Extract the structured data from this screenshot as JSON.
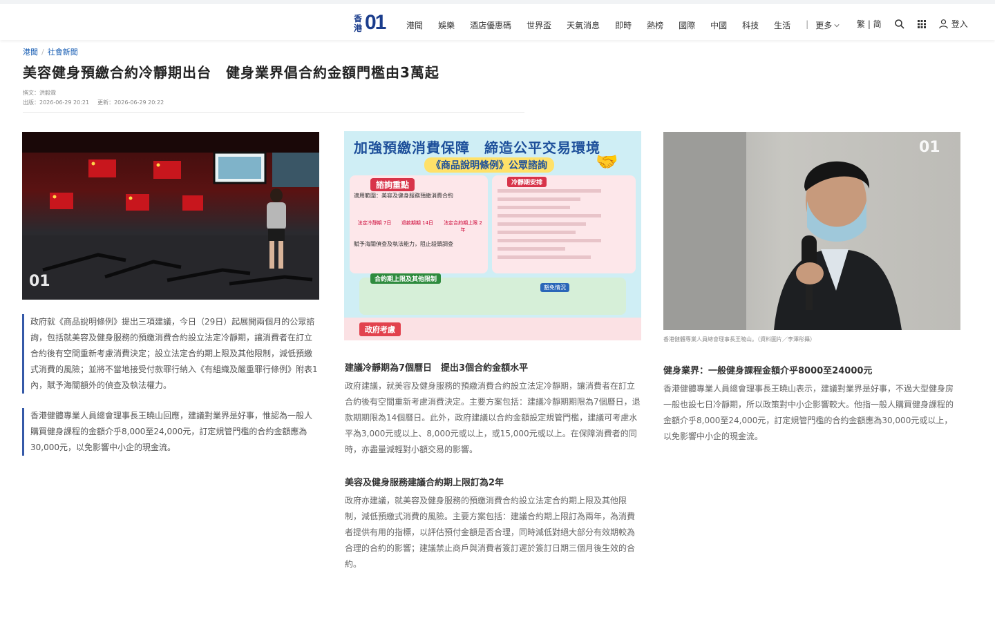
{
  "header": {
    "logo_hk": "香港",
    "logo_mark": "01",
    "nav": [
      "港聞",
      "娛樂",
      "酒店優惠碼",
      "世界盃",
      "天氣消息",
      "即時",
      "熱榜",
      "國際",
      "中國",
      "科技",
      "生活"
    ],
    "more": "更多",
    "lang": "繁 | 简",
    "login": "登入"
  },
  "breadcrumb": [
    "港聞",
    "社會新聞"
  ],
  "article": {
    "title": "美容健身預繳合約冷靜期出台　健身業界倡合約金額門檻由3萬起",
    "author": "撰文：洪毅霖",
    "published": "出版：2026-06-29 20:21",
    "updated": "更新：2026-06-29 20:22"
  },
  "col_left": {
    "quote1": "政府就《商品說明條例》提出三項建議，今日（29日）起展開兩個月的公眾諮詢，包括就美容及健身服務的預繳消費合約設立法定冷靜期，讓消費者在訂立合約後有空間重新考慮消費決定；設立法定合約期上限及其他限制，減低預繳式消費的風險；並將不當地接受付款罪行納入《有組織及嚴重罪行條例》附表1內，賦予海關額外的偵查及執法權力。",
    "quote2": "香港健體專業人員總會理事長王曉山回應，建議對業界是好事，惟認為一般人購買健身課程的金額介乎8,000至24,000元，訂定規管門檻的合約金額應為30,000元，以免影響中小企的現金流。"
  },
  "infographic": {
    "title": "加強預繳消費保障　締造公平交易環境",
    "subtitle": "《商品說明條例》公眾諮詢",
    "section1": "諮詢重點",
    "scope": "適用範圍：美容及健身服務預繳消費合約",
    "cool": "法定冷靜期 7日",
    "refund": "退款期期 14日",
    "limit": "法定合約期上限 2年",
    "customs": "賦予海關偵查及執法能力，阻止殺頭調查",
    "section2": "冷靜期安排",
    "section3": "合約期上限及其他限制",
    "exempt": "豁免情況",
    "consult": "政府考慮"
  },
  "col_mid": {
    "h1": "建議冷靜期為7個曆日　提出3個合約金額水平",
    "p1": "政府建議，就美容及健身服務的預繳消費合約設立法定冷靜期，讓消費者在訂立合約後有空間重新考慮消費決定。主要方案包括：建議冷靜期期限為7個曆日，退款期期限為14個曆日。此外，政府建議以合約金額設定規管門檻，建議可考慮水平為3,000元或以上、8,000元或以上，或15,000元或以上。在保障消費者的同時，亦盡量減輕對小額交易的影響。",
    "h2": "美容及健身服務建議合約期上限訂為2年",
    "p2": "政府亦建議，就美容及健身服務的預繳消費合約設立法定合約期上限及其他限制，減低預繳式消費的風險。主要方案包括：建議合約期上限訂為兩年，為消費者提供有用的指標，以評估預付金額是否合理，同時減低對絕大部分有效期較為合理的合約的影響；建議禁止商戶與消費者簽訂遲於簽訂日期三個月後生效的合約。"
  },
  "col_right": {
    "caption": "香港健體專業人員總會理事長王曉山。（資料圖片／李澤彤攝）",
    "h1": "健身業界：一般健身課程金額介乎8000至24000元",
    "p1": "香港健體專業人員總會理事長王曉山表示，建議對業界是好事，不過大型健身房一般也設七日冷靜期，所以政策對中小企影響較大。他指一般人購買健身課程的金額介乎8,000至24,000元，訂定規管門檻的合約金額應為30,000元或以上，以免影響中小企的現金流。"
  },
  "colors": {
    "accent": "#1a3c8c",
    "quote_bar": "#3559a8",
    "link": "#1a5fb4"
  }
}
